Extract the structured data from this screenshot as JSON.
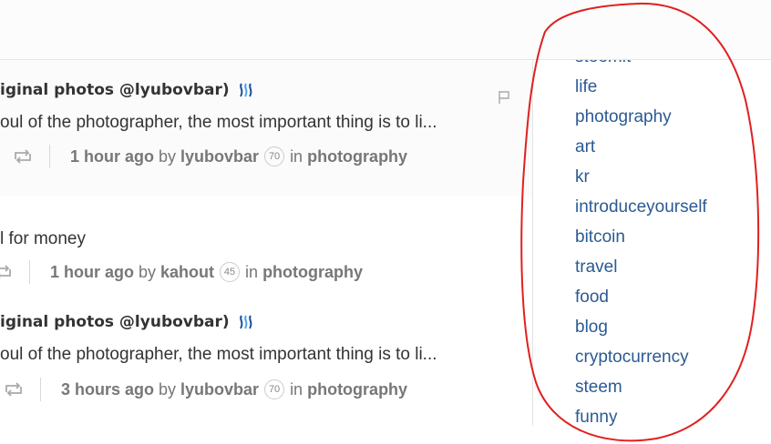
{
  "feed": {
    "posts": [
      {
        "title": "iginal photos @lyubovbar)",
        "body": "oul of the photographer, the most important thing is to li...",
        "time": "1 hour ago",
        "by": "by",
        "author": "lyubovbar",
        "reputation": "70",
        "in": "in",
        "category": "photography"
      },
      {
        "body": "l for money",
        "time": "1 hour ago",
        "by": "by",
        "author": "kahout",
        "reputation": "45",
        "in": "in",
        "category": "photography"
      },
      {
        "title": "iginal photos @lyubovbar)",
        "body": "oul of the photographer, the most important thing is to li...",
        "time": "3 hours ago",
        "by": "by",
        "author": "lyubovbar",
        "reputation": "70",
        "in": "in",
        "category": "photography"
      }
    ]
  },
  "sidebar": {
    "tags": [
      "steemit",
      "life",
      "photography",
      "art",
      "kr",
      "introduceyourself",
      "bitcoin",
      "travel",
      "food",
      "blog",
      "cryptocurrency",
      "steem",
      "funny"
    ]
  },
  "colors": {
    "tag_link": "#2b5a93",
    "annotation": "#e02020",
    "meta_text": "#777777"
  },
  "icons": [
    "steem-logo-icon",
    "resteem-icon",
    "flag-icon"
  ]
}
